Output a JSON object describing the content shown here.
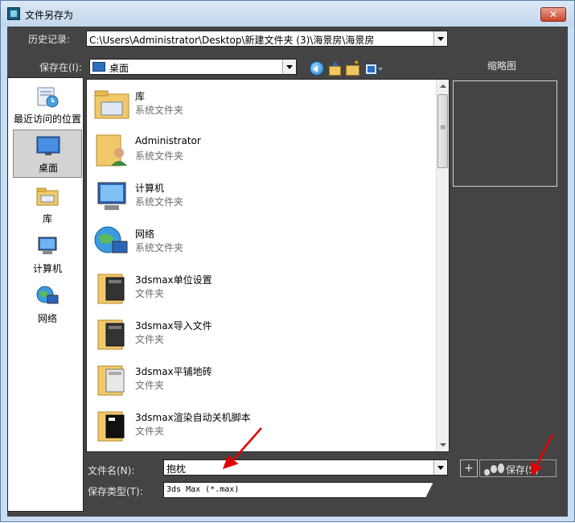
{
  "window": {
    "title": "文件另存为",
    "close_glyph": "✕"
  },
  "history": {
    "label": "历史记录:",
    "value": "C:\\Users\\Administrator\\Desktop\\新建文件夹 (3)\\海景房\\海景房"
  },
  "save_in": {
    "label": "保存在(I):",
    "value": "桌面"
  },
  "thumbnail": {
    "label": "缩略图"
  },
  "toolbar": {
    "icons": [
      "back-icon",
      "up-folder-icon",
      "new-folder-icon",
      "view-menu-icon"
    ]
  },
  "places": [
    {
      "label": "最近访问的位置",
      "icon": "recent-places-icon"
    },
    {
      "label": "桌面",
      "icon": "desktop-icon",
      "selected": true
    },
    {
      "label": "库",
      "icon": "library-icon"
    },
    {
      "label": "计算机",
      "icon": "computer-icon"
    },
    {
      "label": "网络",
      "icon": "network-icon"
    }
  ],
  "files": [
    {
      "name": "库",
      "type": "系统文件夹",
      "icon": "library-folder-icon"
    },
    {
      "name": "Administrator",
      "type": "系统文件夹",
      "icon": "user-folder-icon"
    },
    {
      "name": "计算机",
      "type": "系统文件夹",
      "icon": "computer-icon"
    },
    {
      "name": "网络",
      "type": "系统文件夹",
      "icon": "network-icon"
    },
    {
      "name": "3dsmax单位设置",
      "type": "文件夹",
      "icon": "folder-icon"
    },
    {
      "name": "3dsmax导入文件",
      "type": "文件夹",
      "icon": "folder-icon"
    },
    {
      "name": "3dsmax平铺地砖",
      "type": "文件夹",
      "icon": "folder-icon"
    },
    {
      "name": "3dsmax渲染自动关机脚本",
      "type": "文件夹",
      "icon": "folder-icon"
    }
  ],
  "filename": {
    "label": "文件名(N):",
    "value": "抱枕"
  },
  "filetype": {
    "label": "保存类型(T):",
    "value": "3ds Max (*.max)"
  },
  "buttons": {
    "plus_label": "+",
    "save_label": "保存(S)"
  },
  "colors": {
    "dialog_bg": "#444444",
    "titlebar": "#c9dcf0",
    "close_red": "#c9442b",
    "annotation_red": "#e00000"
  }
}
